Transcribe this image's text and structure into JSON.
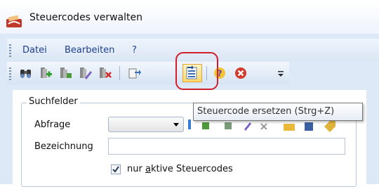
{
  "window": {
    "title": "Steuercodes verwalten"
  },
  "menu": [
    {
      "label": "Datei"
    },
    {
      "label": "Bearbeiten"
    },
    {
      "label": "?"
    }
  ],
  "toolbar": {
    "buttons": [
      {
        "icon": "binoculars-icon"
      },
      {
        "icon": "add-record-icon"
      },
      {
        "icon": "copy-record-icon"
      },
      {
        "icon": "edit-record-icon"
      },
      {
        "icon": "delete-record-icon"
      },
      {
        "icon": "export-icon"
      },
      {
        "icon": "replace-code-icon"
      },
      {
        "icon": "help-icon"
      },
      {
        "icon": "close-icon"
      }
    ],
    "active_color": "#ffd86b"
  },
  "tooltip": {
    "text": "Steuercode ersetzen (Strg+Z)"
  },
  "search": {
    "group_label": "Suchfelder",
    "abfrage_label": "Abfrage",
    "abfrage_value": "",
    "bezeichnung_label": "Bezeichnung",
    "bezeichnung_value": "",
    "checkbox_prefix": "nur ",
    "checkbox_accel": "a",
    "checkbox_suffix": "ktive Steuercodes",
    "checkbox_checked": true
  },
  "colors": {
    "highlight_ring": "#d0202b",
    "menu_text": "#1e3f91"
  }
}
